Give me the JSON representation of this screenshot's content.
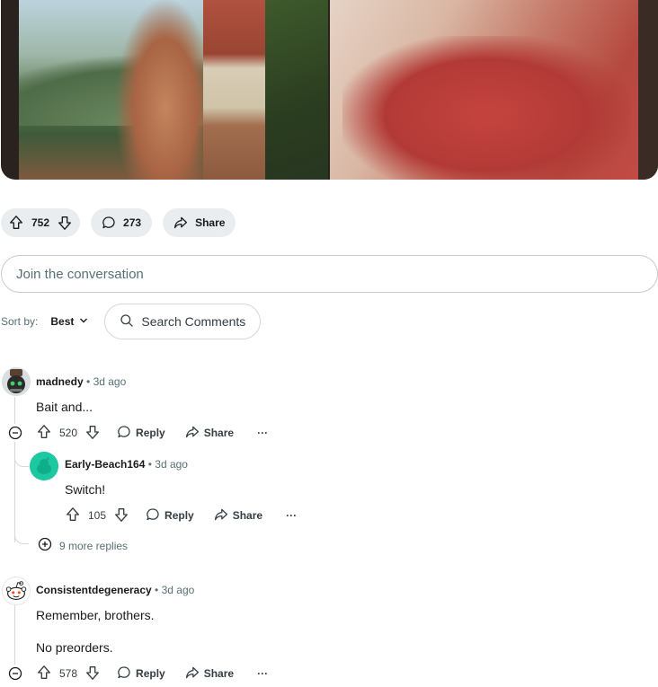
{
  "post_actions": {
    "upvotes": "752",
    "comments": "273",
    "share": "Share"
  },
  "join_placeholder": "Join the conversation",
  "sort": {
    "label": "Sort by:",
    "value": "Best"
  },
  "search_comments": "Search Comments",
  "comments": [
    {
      "user": "madnedy",
      "time": "3d ago",
      "text": "Bait and...",
      "votes": "520",
      "reply": "Reply",
      "share": "Share",
      "more": "···",
      "replies": [
        {
          "user": "Early-Beach164",
          "time": "3d ago",
          "text": "Switch!",
          "votes": "105",
          "reply": "Reply",
          "share": "Share",
          "more": "···"
        }
      ],
      "more_replies": "9 more replies"
    },
    {
      "user": "Consistentdegeneracy",
      "time": "3d ago",
      "text_lines": [
        "Remember, brothers.",
        "No preorders."
      ],
      "votes": "578",
      "reply": "Reply",
      "share": "Share",
      "more": "···"
    }
  ],
  "colors": {
    "pill_bg": "#eaedef",
    "muted_text": "#576f76",
    "avatar_green": "#1dc7a1"
  }
}
